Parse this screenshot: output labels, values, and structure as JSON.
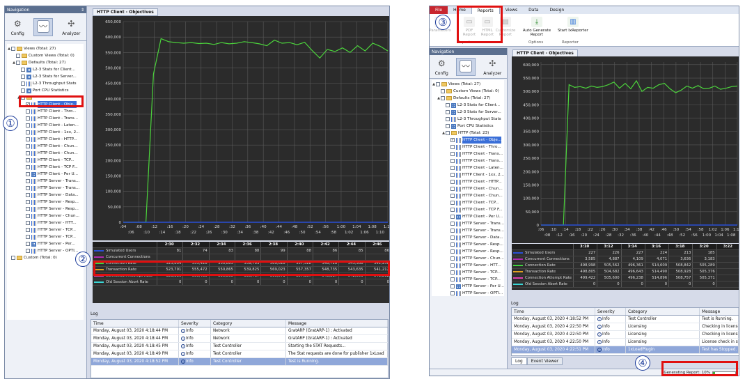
{
  "left": {
    "nav_title": "Navigation",
    "nav_pin": "⇕",
    "buttons": [
      {
        "label": "Config",
        "icon": "gear-icon"
      },
      {
        "label": "",
        "icon": "chart-icon"
      },
      {
        "label": "Analyzer",
        "icon": "analyzer-icon"
      }
    ],
    "tree": [
      {
        "t": "Views (Total: 27)",
        "lvl": 0,
        "tw": "▲",
        "type": "folder"
      },
      {
        "t": "Custom Views (Total: 0)",
        "lvl": 1,
        "type": "folder"
      },
      {
        "t": "Defaults (Total: 27)",
        "lvl": 1,
        "tw": "▲",
        "type": "folder"
      },
      {
        "t": "L2-3 Stats for Client...",
        "lvl": 2,
        "type": "grid"
      },
      {
        "t": "L2-3 Stats for Server...",
        "lvl": 2,
        "type": "grid"
      },
      {
        "t": "L2-3 Throughput Stats",
        "lvl": 2,
        "type": "bars"
      },
      {
        "t": "Port CPU Statistics",
        "lvl": 2,
        "type": "grid"
      },
      {
        "t": "",
        "lvl": 2,
        "type": "folder",
        "tw": "▲"
      },
      {
        "t": "HTTP Client - Obje...",
        "lvl": 3,
        "type": "bars",
        "checked": true,
        "sel": true
      },
      {
        "t": "HTTP Client - Thro...",
        "lvl": 3,
        "type": "bars"
      },
      {
        "t": "HTTP Client - Trans...",
        "lvl": 3,
        "type": "bars"
      },
      {
        "t": "HTTP Client - Laten...",
        "lvl": 3,
        "type": "bars"
      },
      {
        "t": "HTTP Client - 1xx, 2...",
        "lvl": 3,
        "type": "bars"
      },
      {
        "t": "HTTP Client - HTTP...",
        "lvl": 3,
        "type": "bars"
      },
      {
        "t": "HTTP Client - Chun...",
        "lvl": 3,
        "type": "bars"
      },
      {
        "t": "HTTP Client - Chun...",
        "lvl": 3,
        "type": "bars"
      },
      {
        "t": "HTTP Client - TCP...",
        "lvl": 3,
        "type": "bars"
      },
      {
        "t": "HTTP Client - TCP F...",
        "lvl": 3,
        "type": "bars"
      },
      {
        "t": "HTTP Client - Per U...",
        "lvl": 3,
        "type": "grid"
      },
      {
        "t": "HTTP Server - Trans...",
        "lvl": 3,
        "type": "bars"
      },
      {
        "t": "HTTP Server - Trans...",
        "lvl": 3,
        "type": "bars"
      },
      {
        "t": "HTTP Server - Data...",
        "lvl": 3,
        "type": "bars"
      },
      {
        "t": "HTTP Server - Resp...",
        "lvl": 3,
        "type": "bars"
      },
      {
        "t": "HTTP Server - Resp...",
        "lvl": 3,
        "type": "bars"
      },
      {
        "t": "HTTP Server - Chun...",
        "lvl": 3,
        "type": "bars"
      },
      {
        "t": "HTTP Server - HTT...",
        "lvl": 3,
        "type": "bars"
      },
      {
        "t": "HTTP Server - TCP...",
        "lvl": 3,
        "type": "bars"
      },
      {
        "t": "HTTP Server - TCP...",
        "lvl": 3,
        "type": "bars"
      },
      {
        "t": "HTTP Server - Per...",
        "lvl": 3,
        "type": "grid"
      },
      {
        "t": "HTTP Server - OPTI...",
        "lvl": 3,
        "type": "bars"
      },
      {
        "t": "Custom (Total: 0)",
        "lvl": 0,
        "type": "folder"
      }
    ],
    "tab_title": "HTTP Client - Objectives",
    "yticks": [
      "650,000",
      "600,000",
      "550,000",
      "500,000",
      "450,000",
      "400,000",
      "350,000",
      "300,000",
      "250,000",
      "200,000",
      "150,000",
      "100,000",
      "50,000",
      "0"
    ],
    "xticks1": [
      ":04",
      ":08",
      ":12",
      ":16",
      ":20",
      ":24",
      ":28",
      ":32",
      ":36",
      ":40",
      ":44",
      ":48",
      ":52",
      ":56",
      "1:00",
      "1:04",
      "1:08",
      "1:12"
    ],
    "xticks2": [
      ":06",
      ":10",
      ":14",
      ":18",
      ":22",
      ":26",
      ":30",
      ":34",
      ":38",
      ":42",
      ":46",
      ":50",
      ":54",
      ":58",
      "1:02",
      "1:06",
      "1:10"
    ],
    "stat_cols": [
      "2:30",
      "2:32",
      "2:34",
      "2:36",
      "2:38",
      "2:40",
      "2:42",
      "2:44",
      "2:46"
    ],
    "stats": [
      {
        "name": "Simulated Users",
        "color": "#2a4fd6",
        "vals": [
          "81",
          "74",
          "83",
          "88",
          "99",
          "88",
          "86",
          "85",
          "86"
        ]
      },
      {
        "name": "Concurrent Connections",
        "color": "#b02ab0",
        "vals": [
          "",
          "",
          "",
          "",
          "",
          "",
          "",
          "",
          ""
        ]
      },
      {
        "name": "Connection Rate",
        "color": "#3fd13f",
        "vals": [
          "523,804",
          "555,426",
          "550,883",
          "539,793",
          "569,028",
          "557,328",
          "548,728",
          "543,588",
          "541,256"
        ]
      },
      {
        "name": "Transaction Rate",
        "color": "#e0a020",
        "vals": [
          "523,791",
          "555,472",
          "550,865",
          "539,825",
          "569,023",
          "557,357",
          "548,735",
          "543,635",
          "541,212"
        ]
      },
      {
        "name": "Connection Attempt Rate",
        "color": "#e040b0",
        "vals": [
          "523,816",
          "555,486",
          "550,865",
          "539,767",
          "569,071",
          "557,357",
          "548,887",
          "542,599",
          "541,212"
        ]
      },
      {
        "name": "Old Session Abort Rate",
        "color": "#3ad6d6",
        "vals": [
          "0",
          "0",
          "0",
          "0",
          "0",
          "0",
          "0",
          "0",
          "0"
        ]
      }
    ],
    "log_title": "Log",
    "log_cols": [
      "Time",
      "Severity",
      "Category",
      "Message"
    ],
    "log_rows": [
      [
        "Monday, August 03, 2020 4:18:44 PM",
        "Info",
        "Network",
        "GratARP (GratARP-1) : Activated"
      ],
      [
        "Monday, August 03, 2020 4:18:44 PM",
        "Info",
        "Network",
        "GratARP (GratARP-1) : Activated"
      ],
      [
        "Monday, August 03, 2020 4:18:45 PM",
        "Info",
        "Test Controller",
        "Starting the STAT Requests..."
      ],
      [
        "Monday, August 03, 2020 4:18:49 PM",
        "Info",
        "Test Controller",
        "The Stat requests are done for publisher 1xLoad"
      ],
      [
        "Monday, August 03, 2020 4:18:52 PM",
        "Info",
        "Test Controller",
        "Test is Running."
      ]
    ]
  },
  "right": {
    "ribbon_tabs": [
      "File",
      "Home",
      "Reports",
      "Views",
      "Data",
      "Design"
    ],
    "ribbon_buttons": [
      {
        "label": "Parameters",
        "group": "Reports"
      },
      {
        "label": "PDF Report",
        "group": "Reports"
      },
      {
        "label": "HTML Report",
        "group": "Reports"
      },
      {
        "label": "Customize Report",
        "group": "Reports"
      },
      {
        "label": "Auto Generate Report",
        "group": "Options"
      },
      {
        "label": "Start IxReporter",
        "group": "Reporter"
      }
    ],
    "groups": [
      "Reports",
      "Options",
      "Reporter"
    ],
    "nav_title": "Navigation",
    "buttons": [
      {
        "label": "Config",
        "icon": "gear-icon"
      },
      {
        "label": "",
        "icon": "chart-icon"
      },
      {
        "label": "Analyzer",
        "icon": "analyzer-icon"
      }
    ],
    "tree": [
      {
        "t": "Views (Total: 27)",
        "lvl": 0,
        "tw": "▲",
        "type": "folder"
      },
      {
        "t": "Custom Views (Total: 0)",
        "lvl": 1,
        "type": "folder"
      },
      {
        "t": "Defaults (Total: 27)",
        "lvl": 1,
        "tw": "▲",
        "type": "folder"
      },
      {
        "t": "L2-3 Stats for Client...",
        "lvl": 2,
        "type": "grid"
      },
      {
        "t": "L2-3 Stats for Server...",
        "lvl": 2,
        "type": "grid"
      },
      {
        "t": "L2-3 Throughput Stats",
        "lvl": 2,
        "type": "bars"
      },
      {
        "t": "Port CPU Statistics",
        "lvl": 2,
        "type": "grid"
      },
      {
        "t": "HTTP (Total: 23)",
        "lvl": 2,
        "type": "folder",
        "tw": "▲"
      },
      {
        "t": "HTTP Client - Obje...",
        "lvl": 3,
        "type": "bars",
        "checked": true,
        "sel": true
      },
      {
        "t": "HTTP Client - Thro...",
        "lvl": 3,
        "type": "bars"
      },
      {
        "t": "HTTP Client - Trans...",
        "lvl": 3,
        "type": "bars"
      },
      {
        "t": "HTTP Client - Trans...",
        "lvl": 3,
        "type": "bars"
      },
      {
        "t": "HTTP Client - Laten...",
        "lvl": 3,
        "type": "bars"
      },
      {
        "t": "HTTP Client - 1xx, 2...",
        "lvl": 3,
        "type": "bars"
      },
      {
        "t": "HTTP Client - HTTP...",
        "lvl": 3,
        "type": "bars"
      },
      {
        "t": "HTTP Client - Chun...",
        "lvl": 3,
        "type": "bars"
      },
      {
        "t": "HTTP Client - Chun...",
        "lvl": 3,
        "type": "bars"
      },
      {
        "t": "HTTP Client - TCP...",
        "lvl": 3,
        "type": "bars"
      },
      {
        "t": "HTTP Client - TCP F...",
        "lvl": 3,
        "type": "bars"
      },
      {
        "t": "HTTP Client - Per U...",
        "lvl": 3,
        "type": "grid"
      },
      {
        "t": "HTTP Server - Trans...",
        "lvl": 3,
        "type": "bars"
      },
      {
        "t": "HTTP Server - Trans...",
        "lvl": 3,
        "type": "bars"
      },
      {
        "t": "HTTP Server - Data...",
        "lvl": 3,
        "type": "bars"
      },
      {
        "t": "HTTP Server - Resp...",
        "lvl": 3,
        "type": "bars"
      },
      {
        "t": "HTTP Server - Resp...",
        "lvl": 3,
        "type": "bars"
      },
      {
        "t": "HTTP Server - Chun...",
        "lvl": 3,
        "type": "bars"
      },
      {
        "t": "HTTP Server - HTT...",
        "lvl": 3,
        "type": "bars"
      },
      {
        "t": "HTTP Server - TCP...",
        "lvl": 3,
        "type": "bars"
      },
      {
        "t": "HTTP Server - TCP...",
        "lvl": 3,
        "type": "bars"
      },
      {
        "t": "HTTP Server - Per U...",
        "lvl": 3,
        "type": "grid"
      },
      {
        "t": "HTTP Server - OPTI...",
        "lvl": 3,
        "type": "bars"
      },
      {
        "t": "Custom (Total: 0)",
        "lvl": 0,
        "type": "folder"
      }
    ],
    "tab_title": "HTTP Client - Objectives",
    "yticks": [
      "600,000",
      "550,000",
      "500,000",
      "450,000",
      "400,000",
      "350,000",
      "300,000",
      "250,000",
      "200,000",
      "150,000",
      "100,000",
      "50,000",
      "0"
    ],
    "xticks1": [
      ":06",
      ":10",
      ":14",
      ":18",
      ":22",
      ":26",
      ":30",
      ":34",
      ":38",
      ":42",
      ":46",
      ":50",
      ":54",
      ":58",
      "1:02",
      "1:06",
      "1:10"
    ],
    "xticks2": [
      ":08",
      ":12",
      ":16",
      ":20",
      ":24",
      ":28",
      ":32",
      ":36",
      ":40",
      ":44",
      ":48",
      ":52",
      ":56",
      "1:00",
      "1:04",
      "1:08"
    ],
    "stat_cols": [
      "3:10",
      "3:12",
      "3:14",
      "3:16",
      "3:18",
      "3:20",
      "3:22"
    ],
    "stats": [
      {
        "name": "Simulated Users",
        "color": "#2a4fd6",
        "vals": [
          "227",
          "226",
          "227",
          "224",
          "213",
          "185",
          ""
        ]
      },
      {
        "name": "Concurrent Connections",
        "color": "#b02ab0",
        "vals": [
          "3,585",
          "4,887",
          "4,109",
          "4,071",
          "3,636",
          "3,183",
          ""
        ]
      },
      {
        "name": "Connection Rate",
        "color": "#3fd13f",
        "vals": [
          "498,998",
          "505,562",
          "496,361",
          "514,609",
          "508,842",
          "505,289",
          ""
        ]
      },
      {
        "name": "Transaction Rate",
        "color": "#e0a020",
        "vals": [
          "498,805",
          "504,682",
          "496,643",
          "514,490",
          "508,928",
          "505,376",
          ""
        ]
      },
      {
        "name": "Connection Attempt Rate",
        "color": "#e040b0",
        "vals": [
          "499,422",
          "505,600",
          "496,238",
          "514,896",
          "508,757",
          "505,371",
          ""
        ]
      },
      {
        "name": "Old Session Abort Rate",
        "color": "#3ad6d6",
        "vals": [
          "0",
          "0",
          "0",
          "0",
          "0",
          "0",
          ""
        ]
      }
    ],
    "log_title": "Log",
    "log_cols": [
      "Time",
      "Severity",
      "Category",
      "Message"
    ],
    "log_rows": [
      [
        "Monday, August 03, 2020 4:18:52 PM",
        "Info",
        "Test Controller",
        "Test is Running."
      ],
      [
        "Monday, August 03, 2020 4:22:50 PM",
        "Info",
        "Licensing",
        "Checking in license"
      ],
      [
        "Monday, August 03, 2020 4:22:50 PM",
        "Info",
        "Licensing",
        "Checking in license"
      ],
      [
        "Monday, August 03, 2020 4:22:50 PM",
        "Info",
        "Licensing",
        "License check in su"
      ],
      [
        "Monday, August 03, 2020 4:22:51 PM",
        "Info",
        "1xLoadPlugin",
        "Test has Stopped."
      ]
    ],
    "bottom_tabs": [
      "Log",
      "Event Viewer"
    ],
    "status": "Generating Report: 10%"
  },
  "callouts": [
    "①",
    "②",
    "③",
    "④"
  ],
  "chart_data": [
    {
      "type": "line",
      "series": [
        {
          "name": "Connection Rate",
          "x": [
            0,
            1,
            2,
            3,
            4,
            5,
            6,
            7,
            8,
            9,
            10,
            11,
            12,
            13,
            14,
            15,
            16,
            17,
            18,
            19,
            20,
            21,
            22,
            23,
            24,
            25,
            26,
            27,
            28,
            29,
            30,
            31,
            32,
            33,
            34,
            35
          ],
          "y": [
            0,
            0,
            0,
            0,
            480000,
            595000,
            585000,
            582000,
            580000,
            582000,
            579000,
            580000,
            576000,
            582000,
            578000,
            580000,
            585000,
            582000,
            578000,
            572000,
            590000,
            580000,
            582000,
            575000,
            583000,
            556000,
            532000,
            560000,
            553000,
            565000,
            550000,
            572000,
            555000,
            580000,
            570000,
            555000
          ]
        }
      ],
      "ylim": [
        0,
        650000
      ]
    },
    {
      "type": "line",
      "series": [
        {
          "name": "Connection Rate",
          "x": [
            0,
            1,
            2,
            3,
            4,
            5,
            6,
            7,
            8,
            9,
            10,
            11,
            12,
            13,
            14,
            15,
            16,
            17,
            18,
            19,
            20,
            21,
            22,
            23,
            24,
            25,
            26,
            27,
            28,
            29,
            30,
            31,
            32,
            33,
            34,
            35
          ],
          "y": [
            0,
            0,
            0,
            0,
            0,
            525000,
            515000,
            518000,
            512000,
            520000,
            515000,
            518000,
            525000,
            535000,
            512000,
            530000,
            510000,
            540000,
            500000,
            515000,
            512000,
            525000,
            530000,
            510000,
            495000,
            505000,
            520000,
            512000,
            522000,
            510000,
            512000,
            520000,
            508000,
            512000,
            518000,
            520000
          ]
        }
      ],
      "ylim": [
        0,
        610000
      ]
    }
  ]
}
